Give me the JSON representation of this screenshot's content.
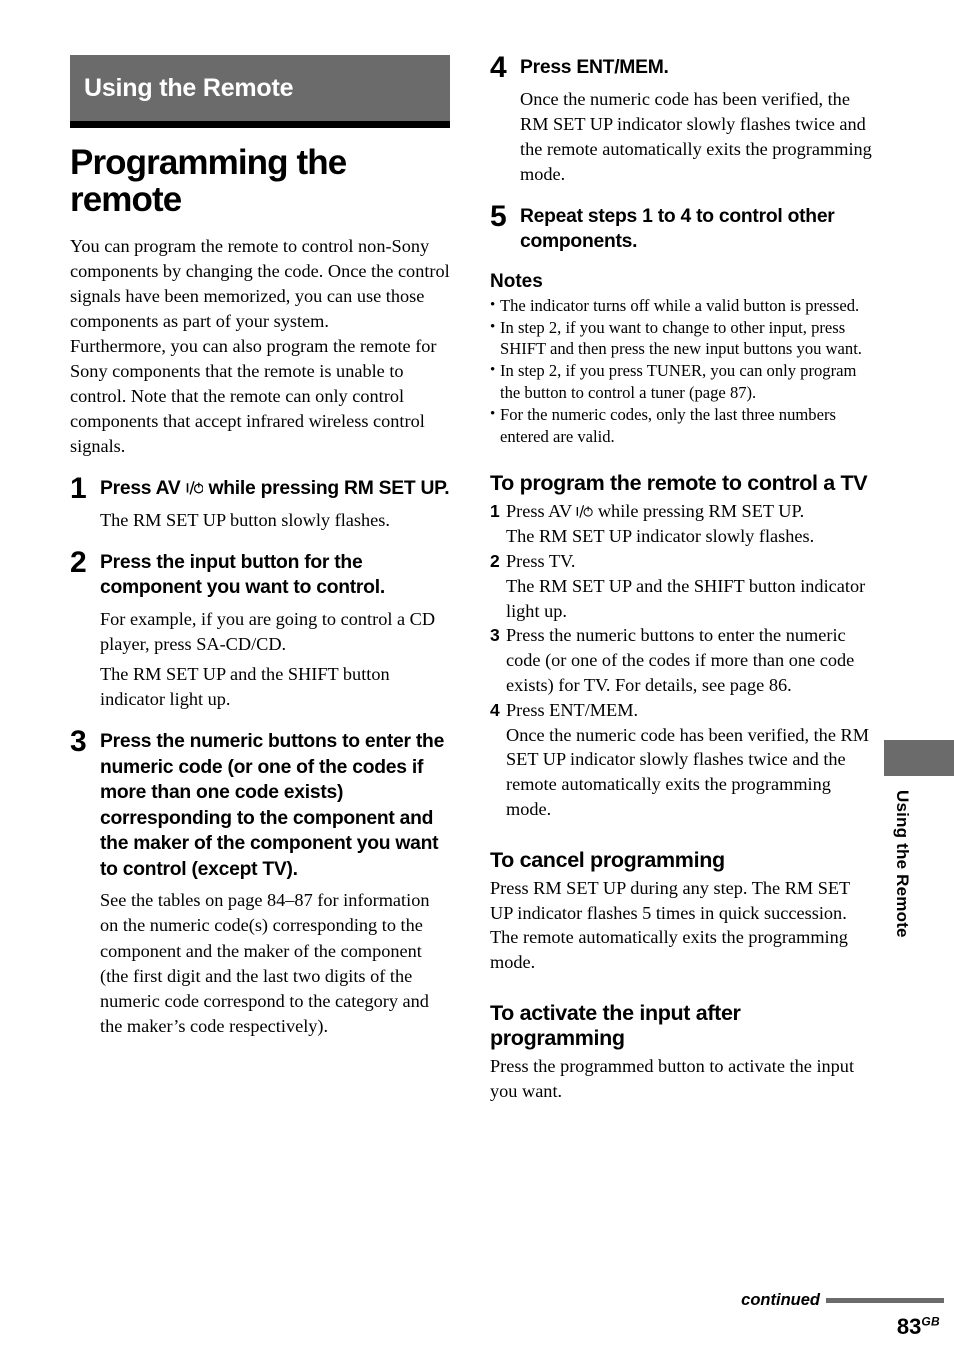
{
  "section_banner": {
    "title": "Using the Remote"
  },
  "page_title": "Programming the remote",
  "intro": {
    "paragraph1": "You can program the remote to control non-Sony components by changing the code. Once the control signals have been memorized, you can use those components as part of your system.",
    "paragraph2": "Furthermore, you can also program the remote for Sony components that the remote is unable to control. Note that the remote can only control components that accept infrared wireless control signals."
  },
  "main_steps": [
    {
      "number": "1",
      "heading_before": "Press AV ",
      "heading_symbol": "I/power-icon",
      "heading_after": " while pressing RM SET UP.",
      "description": "The RM SET UP button slowly flashes."
    },
    {
      "number": "2",
      "heading": "Press the input button for the component you want to control.",
      "description_line1": "For example, if you are going to control a CD player, press SA-CD/CD.",
      "description_line2": "The RM SET UP and the SHIFT button indicator light up."
    },
    {
      "number": "3",
      "heading": "Press the numeric buttons to enter the numeric code (or one of the codes if more than one code exists) corresponding to the component and the maker of the component you want to control (except TV).",
      "description": "See the tables on page 84–87 for information on the numeric code(s) corresponding to the component and the maker of the component (the first digit and the last two digits of the numeric code correspond to the category and the maker’s code respectively)."
    },
    {
      "number": "4",
      "heading": "Press ENT/MEM.",
      "description": "Once the numeric code has been verified, the RM SET UP indicator slowly flashes twice and the remote automatically exits the programming mode."
    },
    {
      "number": "5",
      "heading": "Repeat steps 1 to 4 to control other components."
    }
  ],
  "notes": {
    "title": "Notes",
    "bullet_char": "•",
    "items": [
      "The indicator turns off while a valid button is pressed.",
      "In step 2, if you want to change to other input, press SHIFT and then press the new input buttons you want.",
      "In step 2, if you press TUNER, you can only program the button to control a tuner (page 87).",
      "For the numeric codes, only the last three numbers entered are valid."
    ]
  },
  "tv_section": {
    "heading": "To program the remote to control a TV",
    "steps": [
      {
        "number": "1",
        "text_before": "Press AV ",
        "symbol": "I/power-icon",
        "text_after": " while pressing RM SET UP.",
        "detail": "The RM SET UP indicator slowly flashes."
      },
      {
        "number": "2",
        "text": "Press TV.",
        "detail": "The RM SET UP and the SHIFT button indicator light up."
      },
      {
        "number": "3",
        "text": "Press the numeric buttons to enter the numeric code (or one of the codes if more than one code exists) for TV. For details, see page 86."
      },
      {
        "number": "4",
        "text": "Press ENT/MEM.",
        "detail": "Once the numeric code has been verified, the RM SET UP indicator slowly flashes twice and the remote automatically exits the programming mode."
      }
    ]
  },
  "cancel_section": {
    "heading": "To cancel programming",
    "body": "Press RM SET UP during any step. The RM SET UP indicator flashes 5 times in quick succession. The remote automatically exits the programming mode."
  },
  "activate_section": {
    "heading": "To activate the input after programming",
    "body": "Press the programmed button to activate the input you want."
  },
  "side_tab": {
    "label": "Using the Remote"
  },
  "footer": {
    "continued": "continued",
    "page_number": "83",
    "page_suffix": "GB"
  },
  "colors": {
    "banner_gray": "#6b6b6b",
    "rule_black": "#000000"
  }
}
